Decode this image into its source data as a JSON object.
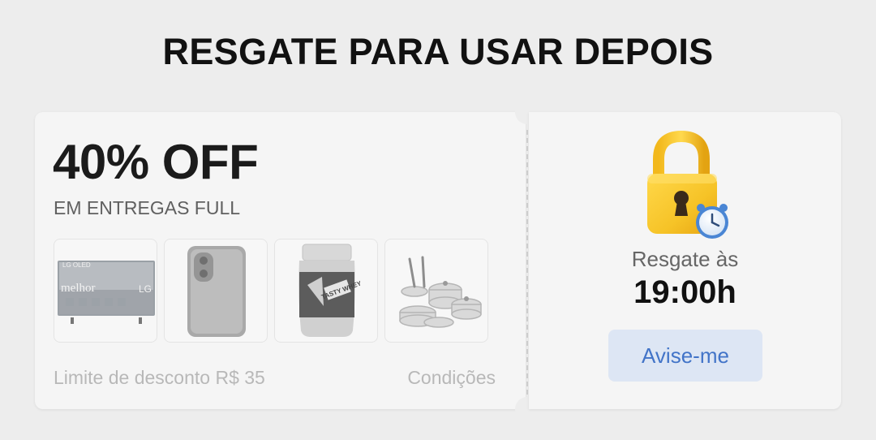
{
  "page": {
    "headline": "RESGATE PARA USAR DEPOIS"
  },
  "coupon": {
    "discount": "40% OFF",
    "subtitle": "EM ENTREGAS FULL",
    "products": [
      {
        "name": "tv-thumbnail",
        "label_brand": "LG",
        "label_text": "melhor",
        "label_top": "LG OLED"
      },
      {
        "name": "phone-thumbnail"
      },
      {
        "name": "supplement-thumbnail",
        "label_text": "TASTY WHEY"
      },
      {
        "name": "cookware-thumbnail"
      }
    ],
    "limit_text": "Limite de desconto R$ 35",
    "conditions_link": "Condições"
  },
  "redeem": {
    "icon": "lock-clock-icon",
    "label": "Resgate às",
    "time": "19:00h",
    "notify_button": "Avise-me"
  },
  "colors": {
    "background": "#ededed",
    "card": "#f5f5f5",
    "lock_yellow": "#f6c327",
    "button_bg": "#dde6f4",
    "button_text": "#4274c8"
  }
}
